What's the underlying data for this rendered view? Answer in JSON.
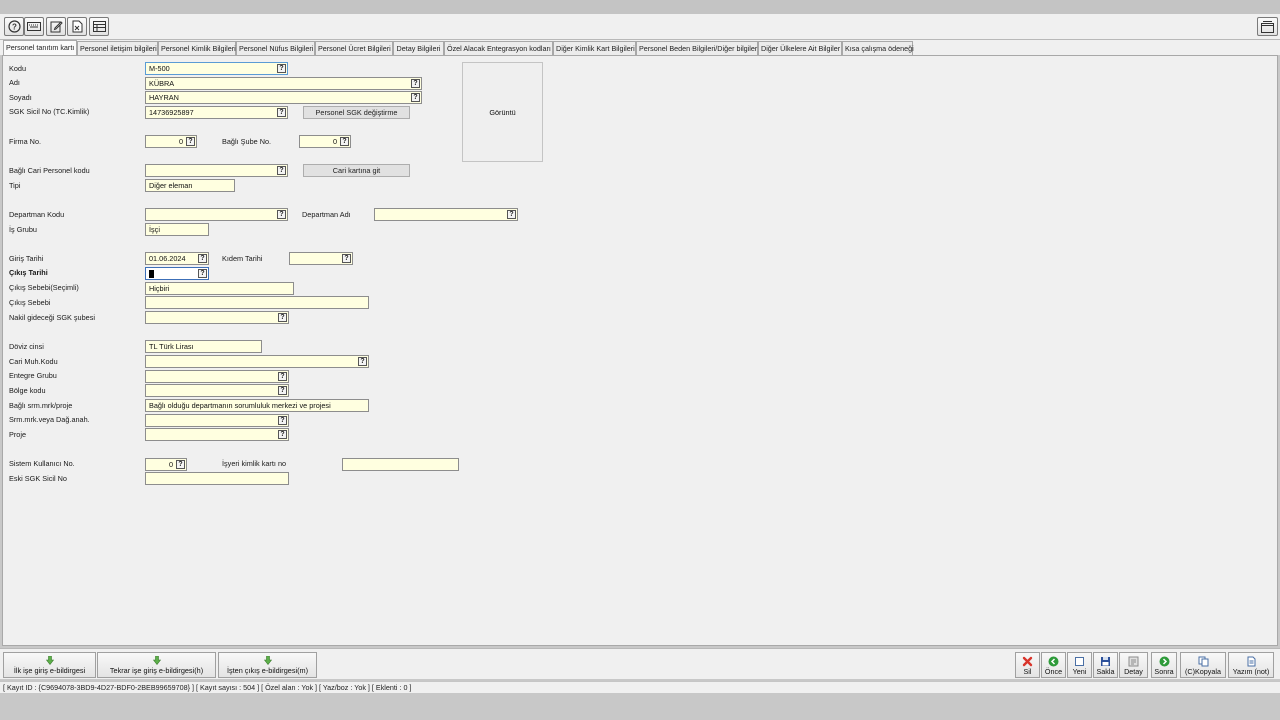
{
  "toolbar": {
    "buttons": [
      "help-icon",
      "keyboard-icon",
      "edit-icon",
      "excel-icon",
      "table-icon"
    ],
    "right_button": "window-icon"
  },
  "tabs": [
    "Personel tanıtım kartı",
    "Personel iletişim bilgileri",
    "Personel Kimlik Bilgileri",
    "Personel Nüfus Bilgileri",
    "Personel Ücret Bilgileri",
    "Detay Bilgileri",
    "Özel Alacak Entegrasyon kodları",
    "Diğer Kimlik Kart Bilgileri",
    "Personel Beden Bilgileri/Diğer bilgiler",
    "Diğer Ülkelere Ait Bilgiler",
    "Kısa çalışma ödeneği"
  ],
  "form": {
    "kodu": {
      "label": "Kodu",
      "value": "M-500"
    },
    "adi": {
      "label": "Adı",
      "value": "KÜBRA"
    },
    "soyadi": {
      "label": "Soyadı",
      "value": "HAYRAN"
    },
    "sgk": {
      "label": "SGK Sicil No (TC.Kimlik)",
      "value": "14736925897",
      "button": "Personel SGK değiştirme"
    },
    "image_label": "Görüntü",
    "firma": {
      "label": "Firma No.",
      "value": "0"
    },
    "sube": {
      "label": "Bağlı Şube No.",
      "value": "0"
    },
    "cari_personel": {
      "label": "Bağlı Cari Personel kodu",
      "value": "",
      "button": "Cari kartına git"
    },
    "tipi": {
      "label": "Tipi",
      "value": "Diğer eleman"
    },
    "departman_kodu": {
      "label": "Departman Kodu",
      "value": ""
    },
    "departman_adi": {
      "label": "Departman Adı",
      "value": ""
    },
    "is_grubu": {
      "label": "İş Grubu",
      "value": "İşçi"
    },
    "giris_tarihi": {
      "label": "Giriş Tarihi",
      "value": "01.06.2024"
    },
    "kidem_tarihi": {
      "label": "Kıdem Tarihi",
      "value": ""
    },
    "cikis_tarihi": {
      "label": "Çıkış Tarihi",
      "value": ""
    },
    "cikis_sebebi_secimli": {
      "label": "Çıkış Sebebi(Seçimli)",
      "value": "Hiçbiri"
    },
    "cikis_sebebi": {
      "label": "Çıkış Sebebi",
      "value": ""
    },
    "nakil": {
      "label": "Nakil gideceği SGK şubesi",
      "value": ""
    },
    "doviz": {
      "label": "Döviz cinsi",
      "value": "TL  Türk Lirası"
    },
    "cari_muh": {
      "label": "Cari Muh.Kodu",
      "value": ""
    },
    "entegre": {
      "label": "Entegre Grubu",
      "value": ""
    },
    "bolge": {
      "label": "Bölge kodu",
      "value": ""
    },
    "srm_proje": {
      "label": "Bağlı srm.mrk/proje",
      "value": "Bağlı olduğu departmanın sorumluluk merkezi ve projesi"
    },
    "srm_dag": {
      "label": "Srm.mrk.veya Dağ.anah.",
      "value": ""
    },
    "proje": {
      "label": "Proje",
      "value": ""
    },
    "sistem_kullanici": {
      "label": "Sistem Kullanıcı No.",
      "value": "0"
    },
    "isyeri_kimlik": {
      "label": "İşyeri kimlik kartı no",
      "value": ""
    },
    "eski_sgk": {
      "label": "Eski SGK Sicil No",
      "value": ""
    }
  },
  "bottom": {
    "ebildirge": [
      "İlk işe giriş e-bildirgesi",
      "Tekrar işe giriş e-bildirgesi(h)",
      "İşten çıkış e-bildirgesi(m)"
    ],
    "actions": [
      {
        "label": "Sil",
        "icon": "delete-icon",
        "color": "#d9342b"
      },
      {
        "label": "Önce",
        "icon": "previous-icon",
        "color": "#2e9b3a"
      },
      {
        "label": "Yeni",
        "icon": "new-icon",
        "color": "#4a6fa5"
      },
      {
        "label": "Sakla",
        "icon": "save-icon",
        "color": "#2b4f9a"
      },
      {
        "label": "Detay",
        "icon": "detail-icon",
        "color": "#8c8c8c"
      },
      {
        "label": "Sonra",
        "icon": "next-icon",
        "color": "#2e9b3a"
      },
      {
        "label": "(C)Kopyala",
        "icon": "copy-icon",
        "color": "#4a6fa5"
      },
      {
        "label": "Yazım (not)",
        "icon": "note-icon",
        "color": "#4a6fa5"
      }
    ]
  },
  "status": "[ Kayıt ID : {C9694078-3BD9-4D27-BDF0-2BEB99659708} ] [ Kayıt sayısı : 504 ] [ Özel alan : Yok ] [ Yaz/boz : Yok ] [ Eklenti : 0 ]"
}
